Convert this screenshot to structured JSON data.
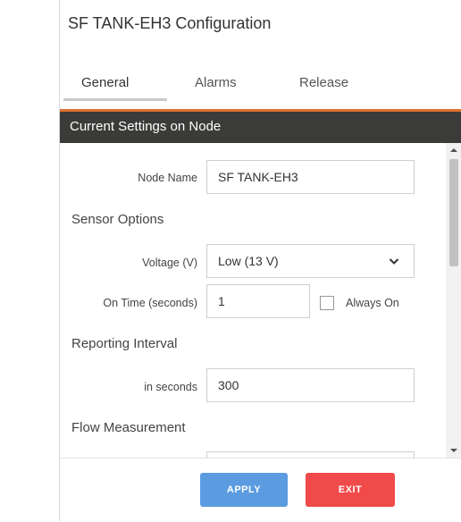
{
  "window": {
    "title": "SF TANK-EH3 Configuration"
  },
  "tabs": [
    {
      "label": "General",
      "active": true
    },
    {
      "label": "Alarms",
      "active": false
    },
    {
      "label": "Release",
      "active": false
    }
  ],
  "section": {
    "title": "Current Settings on Node"
  },
  "form": {
    "node_name": {
      "label": "Node Name",
      "value": "SF TANK-EH3"
    },
    "sensor_options": {
      "heading": "Sensor Options"
    },
    "voltage": {
      "label": "Voltage (V)",
      "value": "Low (13 V)"
    },
    "on_time": {
      "label": "On Time (seconds)",
      "value": "1"
    },
    "always_on": {
      "label": "Always On",
      "checked": false
    },
    "reporting_interval": {
      "heading": "Reporting Interval"
    },
    "interval": {
      "label": "in seconds",
      "value": "300"
    },
    "flow_measurement": {
      "heading": "Flow Measurement"
    }
  },
  "buttons": {
    "apply": "APPLY",
    "exit": "EXIT"
  },
  "colors": {
    "section_bar": "#3b3b39",
    "section_accent": "#e06f2c",
    "apply": "#5b9be0",
    "exit": "#f04a4a"
  },
  "icons": {
    "dropdown": "chevron-down-icon",
    "scroll_up": "scroll-up-arrow-icon",
    "scroll_down": "scroll-down-arrow-icon"
  }
}
